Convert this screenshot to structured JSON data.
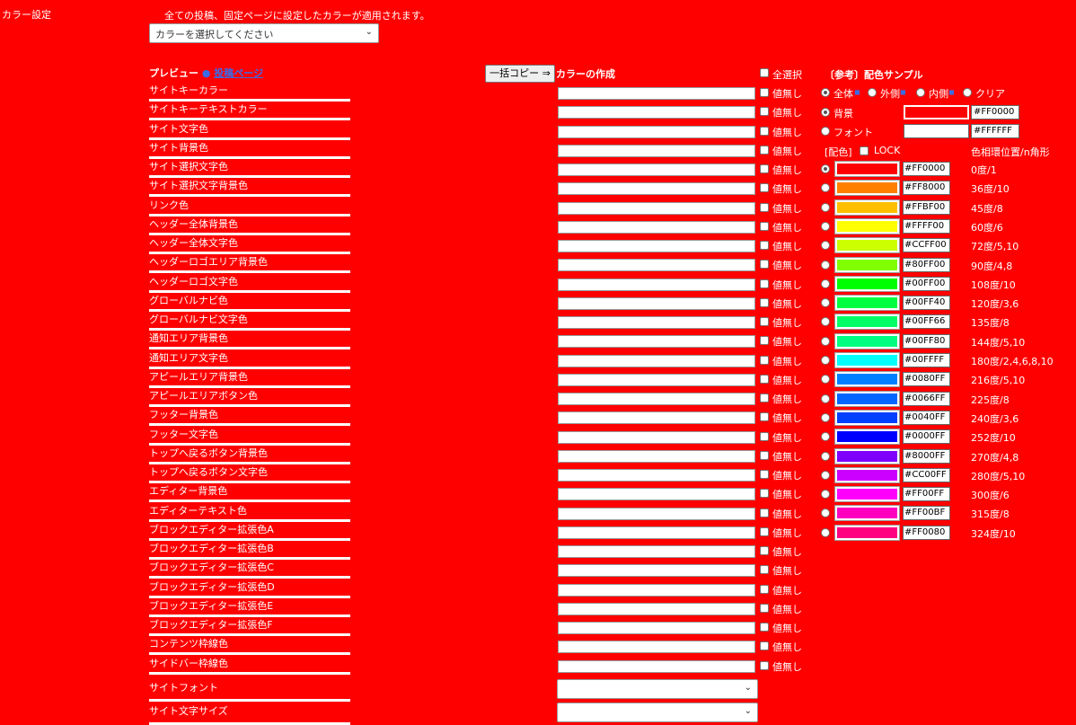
{
  "page": {
    "section_label": "カラー設定",
    "notice": "全ての投稿、固定ページに設定したカラーが適用されます。",
    "color_select_placeholder": "カラーを選択してください"
  },
  "preview": {
    "title": "プレビュー",
    "link_label": "投稿ページ"
  },
  "bulk_copy_label": "一括コピー ⇒",
  "make_colors_label": "カラーの作成",
  "select_all_label": "全選択",
  "no_value_label": "値無し",
  "rows": [
    "サイトキーカラー",
    "サイトキーテキストカラー",
    "サイト文字色",
    "サイト背景色",
    "サイト選択文字色",
    "サイト選択文字背景色",
    "リンク色",
    "ヘッダー全体背景色",
    "ヘッダー全体文字色",
    "ヘッダーロゴエリア背景色",
    "ヘッダーロゴ文字色",
    "グローバルナビ色",
    "グローバルナビ文字色",
    "通知エリア背景色",
    "通知エリア文字色",
    "アピールエリア背景色",
    "アピールエリアボタン色",
    "フッター背景色",
    "フッター文字色",
    "トップへ戻るボタン背景色",
    "トップへ戻るボタン文字色",
    "エディター背景色",
    "エディターテキスト色",
    "ブロックエディター拡張色A",
    "ブロックエディター拡張色B",
    "ブロックエディター拡張色C",
    "ブロックエディター拡張色D",
    "ブロックエディター拡張色E",
    "ブロックエディター拡張色F",
    "コンテンツ枠線色",
    "サイドバー枠線色"
  ],
  "font_rows": [
    "サイトフォント",
    "サイト文字サイズ"
  ],
  "reference": {
    "title": "〔参考〕配色サンプル",
    "scope_options": [
      "全体",
      "外側",
      "内側",
      "クリア"
    ],
    "background_label": "背景",
    "background_hex": "#FF0000",
    "background_color": "#ff0000",
    "font_label": "フォント",
    "font_hex": "#FFFFFF",
    "font_color": "#ffffff",
    "palette_label": "[配色]",
    "lock_label": "LOCK",
    "angle_header": "色相環位置/n角形",
    "palette": [
      {
        "hex": "#FF0000",
        "color": "#ff0000",
        "angle": "0度/1"
      },
      {
        "hex": "#FF8000",
        "color": "#ff8000",
        "angle": "36度/10"
      },
      {
        "hex": "#FFBF00",
        "color": "#ffbf00",
        "angle": "45度/8"
      },
      {
        "hex": "#FFFF00",
        "color": "#ffff00",
        "angle": "60度/6"
      },
      {
        "hex": "#CCFF00",
        "color": "#ccff00",
        "angle": "72度/5,10"
      },
      {
        "hex": "#80FF00",
        "color": "#80ff00",
        "angle": "90度/4,8"
      },
      {
        "hex": "#00FF00",
        "color": "#00ff00",
        "angle": "108度/10"
      },
      {
        "hex": "#00FF40",
        "color": "#00ff40",
        "angle": "120度/3,6"
      },
      {
        "hex": "#00FF66",
        "color": "#00ff66",
        "angle": "135度/8"
      },
      {
        "hex": "#00FF80",
        "color": "#00ff80",
        "angle": "144度/5,10"
      },
      {
        "hex": "#00FFFF",
        "color": "#00ffff",
        "angle": "180度/2,4,6,8,10"
      },
      {
        "hex": "#0080FF",
        "color": "#0080ff",
        "angle": "216度/5,10"
      },
      {
        "hex": "#0066FF",
        "color": "#0066ff",
        "angle": "225度/8"
      },
      {
        "hex": "#0040FF",
        "color": "#0040ff",
        "angle": "240度/3,6"
      },
      {
        "hex": "#0000FF",
        "color": "#0000ff",
        "angle": "252度/10"
      },
      {
        "hex": "#8000FF",
        "color": "#8000ff",
        "angle": "270度/4,8"
      },
      {
        "hex": "#CC00FF",
        "color": "#cc00ff",
        "angle": "280度/5,10"
      },
      {
        "hex": "#FF00FF",
        "color": "#ff00ff",
        "angle": "300度/6"
      },
      {
        "hex": "#FF00BF",
        "color": "#ff00bf",
        "angle": "315度/8"
      },
      {
        "hex": "#FF0080",
        "color": "#ff0080",
        "angle": "324度/10"
      }
    ]
  }
}
